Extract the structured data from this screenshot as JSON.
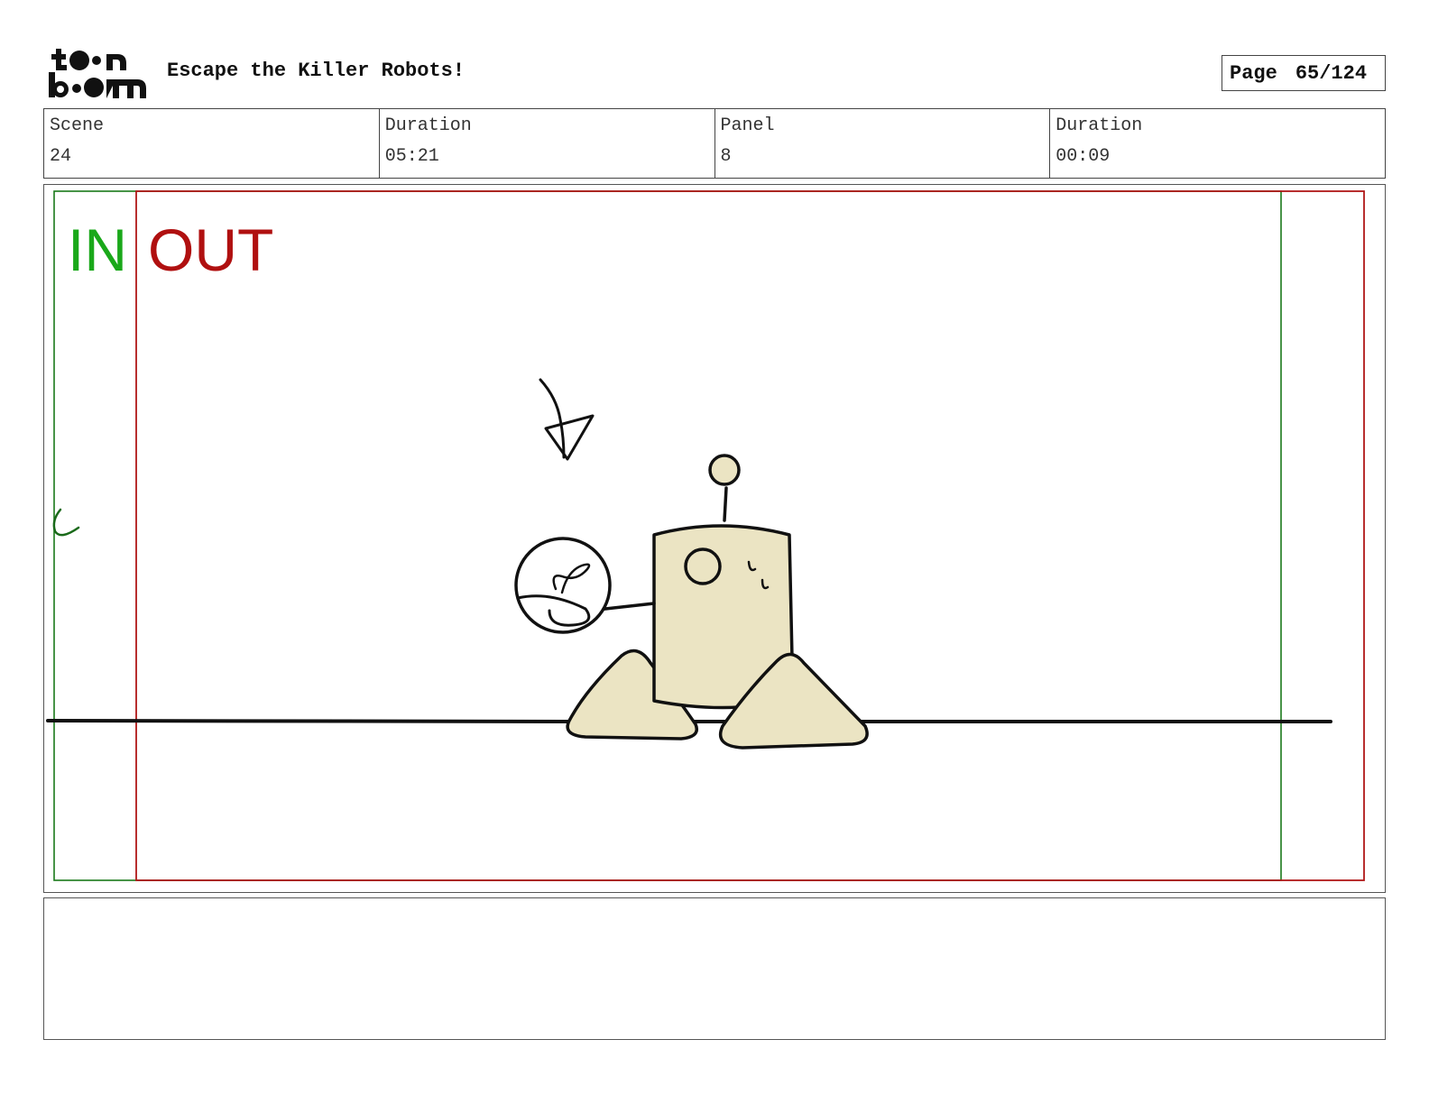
{
  "header": {
    "logo_text": "toon boom",
    "project_title": "Escape the Killer Robots!",
    "page_label": "Page",
    "page_value": "65/124"
  },
  "info": {
    "scene_label": "Scene",
    "scene_value": "24",
    "scene_duration_label": "Duration",
    "scene_duration_value": "05:21",
    "panel_label": "Panel",
    "panel_value": "8",
    "panel_duration_label": "Duration",
    "panel_duration_value": "00:09"
  },
  "panel": {
    "in_label": "IN",
    "out_label": "OUT",
    "in_color": "#1aa81a",
    "out_color": "#b01010",
    "robot_fill": "#ebe4c3"
  },
  "notes": {
    "text": ""
  }
}
